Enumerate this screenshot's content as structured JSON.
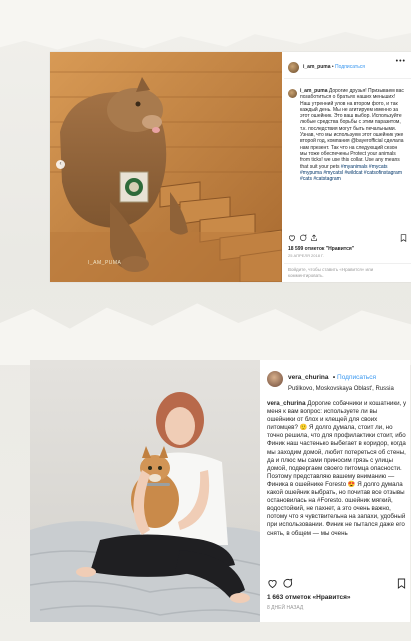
{
  "post1": {
    "username": "i_am_puma",
    "follow_label": "Подписаться",
    "more_label": "•••",
    "watermark": "I_AM_PUMA",
    "caption_user": "i_am_puma",
    "caption": "Дорогие друзья! Призываем вас позаботиться о братьях наших меньших! Наш утренний улов на втором фото, и так каждый день. Мы не агитируем именно за этот ошейник. Это ваш выбор. Используйте любые средства борьбы с этим паразитом, т.к. последствия могут быть печальными. Узнав, что мы используем этот ошейник уже второй год, компания @bayerofficial сделала нам презент. Так что на следующий сезон мы тоже обеспечены Protect your animals from ticks! we use this collar. Use any means that suit your pets",
    "hashtags": "#myanimals #mycats #mypuma #mycatsl #wildcat #catsofinstagram #cats #catstagram",
    "likes": "18 599 отметок \"Нравится\"",
    "date": "25 АПРЕЛЯ 2018 Г.",
    "comment_prompt": "Войдите, чтобы ставить «Нравится» или комментировать.",
    "colors": {
      "follow": "#3897f0",
      "fur": "#9c6b3c",
      "wood": "#c98a48"
    }
  },
  "post2": {
    "username": "vera_churina",
    "follow_label": "Подписаться",
    "location": "Putilkovo, Moskovskaya Oblast', Russia",
    "caption_user": "vera_churina",
    "caption": "Дорогие собачники и кошатники, у меня к вам вопрос: используете ли вы ошейники от блох и клещей для своих питомцев? 🙂 Я долго думала, стоит ли, но точно решила, что для профилактики стоит, ибо Финик наш частенько выбегает в коридор, когда мы заходим домой, любит потереться об стены, да и плюс мы сами приносим грязь с улицы домой, подвергаем своего питомца опасности. Поэтому представляю вашему вниманию — Финика в ошейнике Foresto 😍 Я долго думала какой ошейник выбрать, но почитав все отзывы остановилась на #Foresto. ошейник мягкий, водостойкий, не пахнет, а это очень важно, потому что я чувствительна на запахи, удобный при использовании. Финик не пытался даже его снять, в общем — мы очень",
    "likes": "1 663 отметок «Нравится»",
    "date": "8 ДНЕЙ НАЗАД",
    "icons": [
      "heart-icon",
      "comment-icon",
      "bookmark-icon"
    ]
  }
}
